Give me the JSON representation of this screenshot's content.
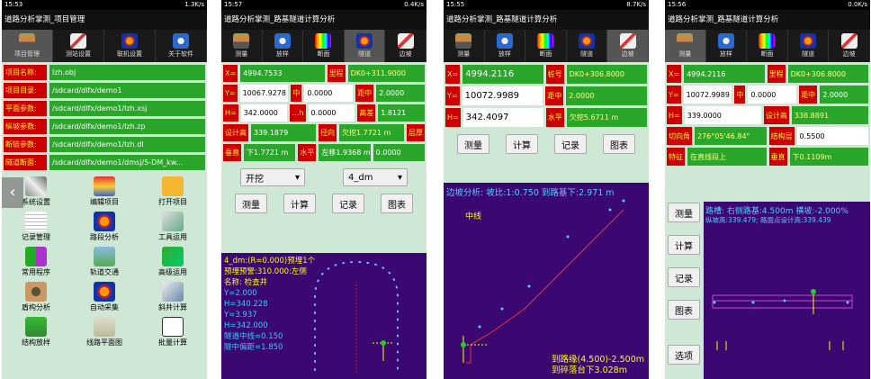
{
  "p1": {
    "time": "15:53",
    "net": "1.3K/s",
    "title": "道路分析掌测_项目管理",
    "tabs": [
      "项目管理",
      "测站设置",
      "联机设置",
      "关于软件"
    ],
    "rows": [
      [
        "项目名称:",
        "lzh.obj"
      ],
      [
        "项目目录:",
        "/sdcard/dlfx/demo1"
      ],
      [
        "平面参数:",
        "/sdcard/dlfx/demo1/lzh.xsj"
      ],
      [
        "纵坡参数:",
        "/sdcard/dlfx/demo1/lzh.zp"
      ],
      [
        "断链参数:",
        "/sdcard/dlfx/demo1/lzh.dl"
      ],
      [
        "隧道断面:",
        "/sdcard/dlfx/demo1/dmsj/5-DM_kw..."
      ]
    ],
    "icons": [
      "系统设置",
      "编辑项目",
      "打开项目",
      "记录管理",
      "路段分析",
      "工具运用",
      "常用程序",
      "轨道交通",
      "高级运用",
      "盾构分析",
      "自动采集",
      "斜井计算",
      "结构放样",
      "线路平面图",
      "批量计算"
    ]
  },
  "p2": {
    "time": "15:57",
    "net": "0.4K/s",
    "title": "道路分析掌测_路基隧道计算分析",
    "tabs": [
      "测量",
      "放样",
      "断面",
      "隧道",
      "边坡"
    ],
    "r1": [
      "X=",
      "4994.7533",
      "里程",
      "DK0+311.9000"
    ],
    "r2": [
      "Y=",
      "10067.9278",
      "中",
      "0.0000",
      "距中",
      "2.0000"
    ],
    "r3": [
      "H=",
      "342.0000",
      "…h",
      "0.0000",
      "高差",
      "1.8121"
    ],
    "r4": [
      "设计高",
      "339.1879",
      "径向",
      "欠挖1.7721 m",
      "层厚"
    ],
    "r5": [
      "垂直",
      "下1.7721 m",
      "水平",
      "左移1.9368 m",
      "0.0000"
    ],
    "sel1": "开挖",
    "sel2": "4_dm",
    "btns": [
      "测量",
      "计算",
      "记录",
      "图表"
    ],
    "info": [
      "4_dm:(R=0.000)预埋1个",
      "预埋预警:310.000:左侧",
      "名称: 检查井",
      "Y=2.000",
      "H=340.228",
      "Y=3.937",
      "H=342.000",
      "隧道中线=0.150",
      "隧中偏距=1.850"
    ]
  },
  "p3": {
    "time": "15:55",
    "net": "8.7K/s",
    "title": "道路分析掌测_路基隧道计算分析",
    "tabs": [
      "测量",
      "放样",
      "断面",
      "隧道",
      "边坡"
    ],
    "r1": [
      "X=",
      "4994.2116",
      "桩号",
      "DK0+306.8000"
    ],
    "r2": [
      "Y=",
      "10072.9989",
      "距中",
      "2.0000"
    ],
    "r3": [
      "H=",
      "342.4097",
      "水平",
      "欠挖5.6711 m"
    ],
    "btns": [
      "测量",
      "计算",
      "记录",
      "图表"
    ],
    "head": "边坡分析: 坡比:1:0.750   到路基下:2.971 m",
    "mid": "中线",
    "foot1": "到路缘(4.500)-2.500m",
    "foot2": "到碎落台下3.028m"
  },
  "p4": {
    "time": "15:56",
    "net": "0.0K/s",
    "title": "道路分析掌测_路基隧道计算分析",
    "tabs": [
      "测量",
      "放样",
      "断面",
      "隧道",
      "边坡"
    ],
    "r1": [
      "X=",
      "4994.2116",
      "里程",
      "DK0+306.8000"
    ],
    "r2": [
      "Y=",
      "10072.9989",
      "中",
      "0.0000",
      "距中",
      "2.0000"
    ],
    "r3": [
      "H=",
      "339.0000",
      "设计高",
      "338.8891"
    ],
    "r4": [
      "切向角",
      "276°05'46.84\"",
      "结构层",
      "0.5500"
    ],
    "r5": [
      "特征",
      "在直线段上",
      "垂直",
      "下0.1109m"
    ],
    "btns": [
      "测量",
      "计算",
      "记录",
      "图表",
      "选项"
    ],
    "info1": "路槽: 右侧路基:4.500m  横坡:-2.000%",
    "info2": "纵坡高:339.479; 路面点设计高:339.439"
  }
}
